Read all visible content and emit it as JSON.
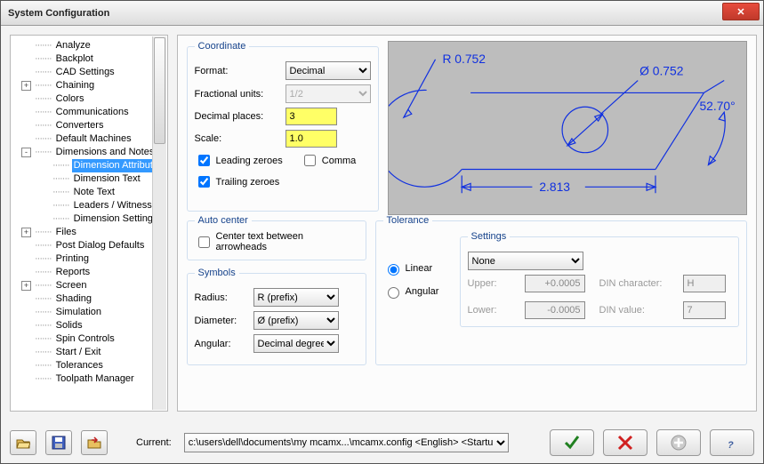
{
  "window": {
    "title": "System Configuration"
  },
  "tree": {
    "items": [
      {
        "label": "Analyze",
        "exp": "",
        "indent": "root"
      },
      {
        "label": "Backplot",
        "exp": "",
        "indent": "root"
      },
      {
        "label": "CAD Settings",
        "exp": "",
        "indent": "root"
      },
      {
        "label": "Chaining",
        "exp": "+",
        "indent": "root"
      },
      {
        "label": "Colors",
        "exp": "",
        "indent": "root"
      },
      {
        "label": "Communications",
        "exp": "",
        "indent": "root"
      },
      {
        "label": "Converters",
        "exp": "",
        "indent": "root"
      },
      {
        "label": "Default Machines",
        "exp": "",
        "indent": "root"
      },
      {
        "label": "Dimensions and Notes",
        "exp": "-",
        "indent": "root"
      },
      {
        "label": "Dimension Attributes",
        "exp": "",
        "indent": "child",
        "sel": true
      },
      {
        "label": "Dimension Text",
        "exp": "",
        "indent": "child"
      },
      {
        "label": "Note Text",
        "exp": "",
        "indent": "child"
      },
      {
        "label": "Leaders / Witness",
        "exp": "",
        "indent": "child"
      },
      {
        "label": "Dimension Settings",
        "exp": "",
        "indent": "child"
      },
      {
        "label": "Files",
        "exp": "+",
        "indent": "root"
      },
      {
        "label": "Post Dialog Defaults",
        "exp": "",
        "indent": "root"
      },
      {
        "label": "Printing",
        "exp": "",
        "indent": "root"
      },
      {
        "label": "Reports",
        "exp": "",
        "indent": "root"
      },
      {
        "label": "Screen",
        "exp": "+",
        "indent": "root"
      },
      {
        "label": "Shading",
        "exp": "",
        "indent": "root"
      },
      {
        "label": "Simulation",
        "exp": "",
        "indent": "root"
      },
      {
        "label": "Solids",
        "exp": "",
        "indent": "root"
      },
      {
        "label": "Spin Controls",
        "exp": "",
        "indent": "root"
      },
      {
        "label": "Start / Exit",
        "exp": "",
        "indent": "root"
      },
      {
        "label": "Tolerances",
        "exp": "",
        "indent": "root"
      },
      {
        "label": "Toolpath Manager",
        "exp": "",
        "indent": "root"
      }
    ]
  },
  "coordinate": {
    "legend": "Coordinate",
    "format_label": "Format:",
    "format_value": "Decimal",
    "frac_label": "Fractional units:",
    "frac_value": "1/2",
    "dec_label": "Decimal places:",
    "dec_value": "3",
    "scale_label": "Scale:",
    "scale_value": "1.0",
    "leading": "Leading zeroes",
    "trailing": "Trailing zeroes",
    "comma": "Comma"
  },
  "preview": {
    "r": "R 0.752",
    "dia": "Ø 0.752",
    "ang": "52.70°",
    "width": "2.813"
  },
  "autocenter": {
    "legend": "Auto center",
    "label": "Center text between arrowheads"
  },
  "symbols": {
    "legend": "Symbols",
    "radius_label": "Radius:",
    "radius_value": "R (prefix)",
    "diameter_label": "Diameter:",
    "diameter_value": "Ø (prefix)",
    "angular_label": "Angular:",
    "angular_value": "Decimal degrees"
  },
  "tolerance": {
    "legend": "Tolerance",
    "linear": "Linear",
    "angular": "Angular",
    "settings_legend": "Settings",
    "mode": "None",
    "upper_label": "Upper:",
    "upper_value": "+0.0005",
    "lower_label": "Lower:",
    "lower_value": "-0.0005",
    "din_char_label": "DIN character:",
    "din_char_value": "H",
    "din_val_label": "DIN value:",
    "din_val_value": "7"
  },
  "bottom": {
    "current_label": "Current:",
    "path": "c:\\users\\dell\\documents\\my mcamx...\\mcamx.config <English> <Startu"
  }
}
